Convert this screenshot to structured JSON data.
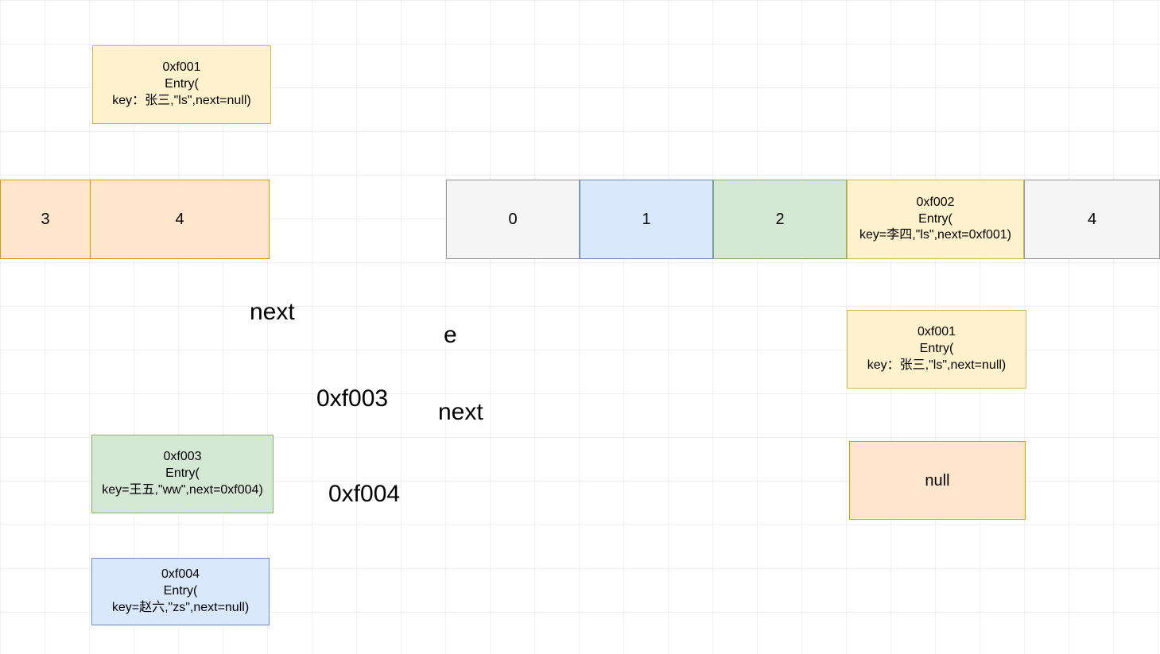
{
  "entries": {
    "f001a": {
      "addr": "0xf001",
      "type": "Entry(",
      "detail": "key：张三,\"ls\",next=null)"
    },
    "f003": {
      "addr": "0xf003",
      "type": "Entry(",
      "detail": "key=王五,\"ww\",next=0xf004)"
    },
    "f004": {
      "addr": "0xf004",
      "type": "Entry(",
      "detail": "key=赵六,\"zs\",next=null)"
    },
    "f002": {
      "addr": "0xf002",
      "type": "Entry(",
      "detail": "key=李四,\"ls\",next=0xf001)"
    },
    "f001b": {
      "addr": "0xf001",
      "type": "Entry(",
      "detail": "key：张三,\"ls\",next=null)"
    }
  },
  "cellsLeft": {
    "c3": "3",
    "c4": "4"
  },
  "cellsRight": {
    "c0": "0",
    "c1": "1",
    "c2": "2",
    "c4": "4"
  },
  "nullBox": "null",
  "labels": {
    "nextTop": "next",
    "e": "e",
    "addr3": "0xf003",
    "nextRight": "next",
    "addr4": "0xf004"
  }
}
